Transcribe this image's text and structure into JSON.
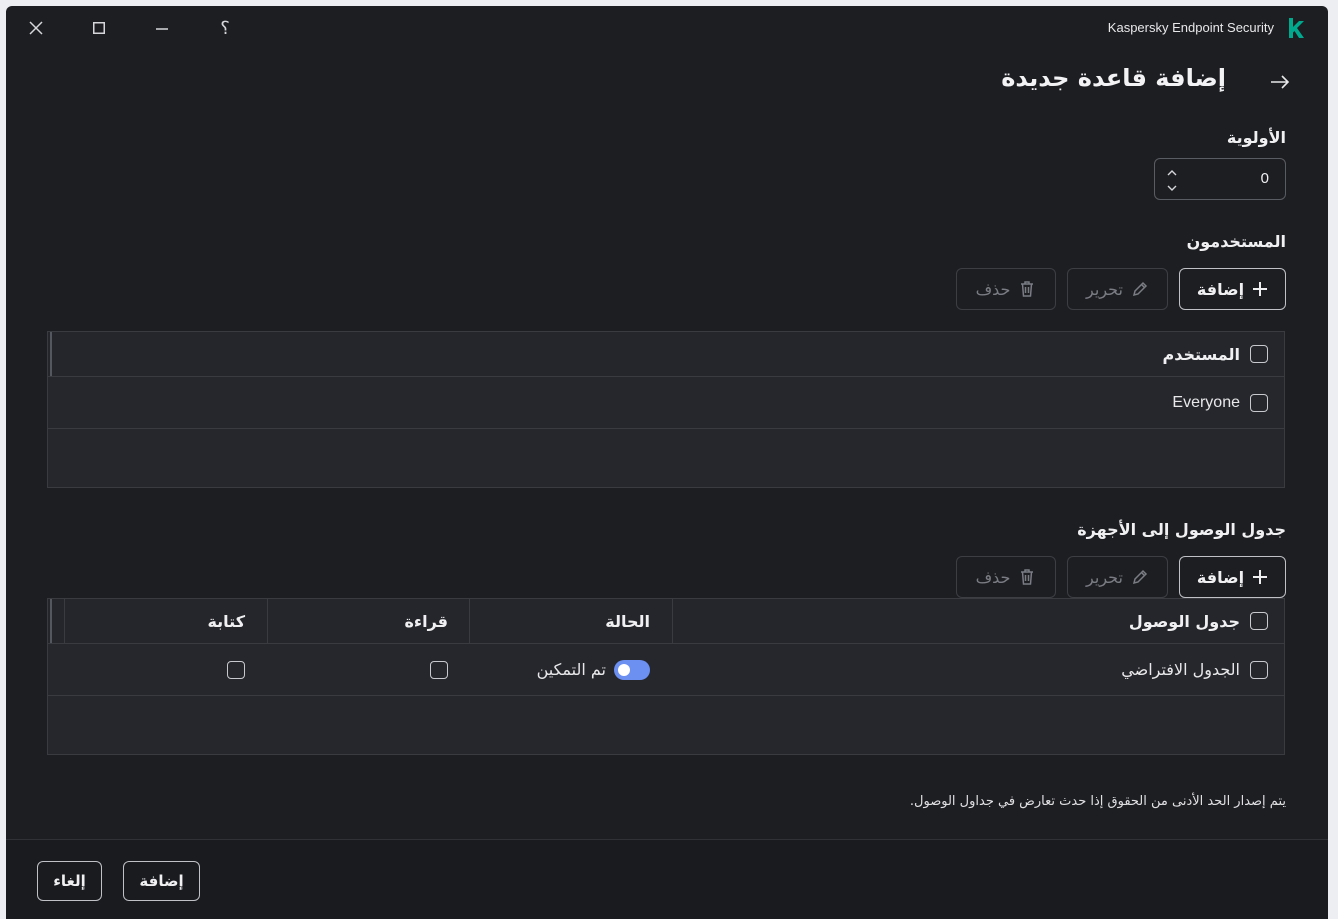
{
  "window": {
    "app_title": "Kaspersky Endpoint Security",
    "help_glyph": "؟",
    "accent": "#00a88e"
  },
  "header": {
    "title": "إضافة قاعدة جديدة"
  },
  "priority": {
    "label": "الأولوية",
    "value": "0"
  },
  "users": {
    "label": "المستخدمون",
    "add_label": "إضافة",
    "edit_label": "تحرير",
    "delete_label": "حذف",
    "column_header": "المستخدم",
    "rows": [
      {
        "name": "Everyone"
      }
    ]
  },
  "access_schedule": {
    "label": "جدول الوصول إلى الأجهزة",
    "add_label": "إضافة",
    "edit_label": "تحرير",
    "delete_label": "حذف",
    "columns": {
      "schedule": "جدول الوصول",
      "status": "الحالة",
      "read": "قراءة",
      "write": "كتابة"
    },
    "rows": [
      {
        "schedule": "الجدول الافتراضي",
        "status": "تم التمكين",
        "enabled": true,
        "read": false,
        "write": false
      }
    ]
  },
  "note": "يتم إصدار الحد الأدنى من الحقوق إذا حدث تعارض في جداول الوصول.",
  "footer": {
    "add_label": "إضافة",
    "cancel_label": "إلغاء"
  },
  "colors": {
    "background": "#1d1e22",
    "table_bg": "#26272c",
    "toggle_on": "#6c8ff2"
  }
}
